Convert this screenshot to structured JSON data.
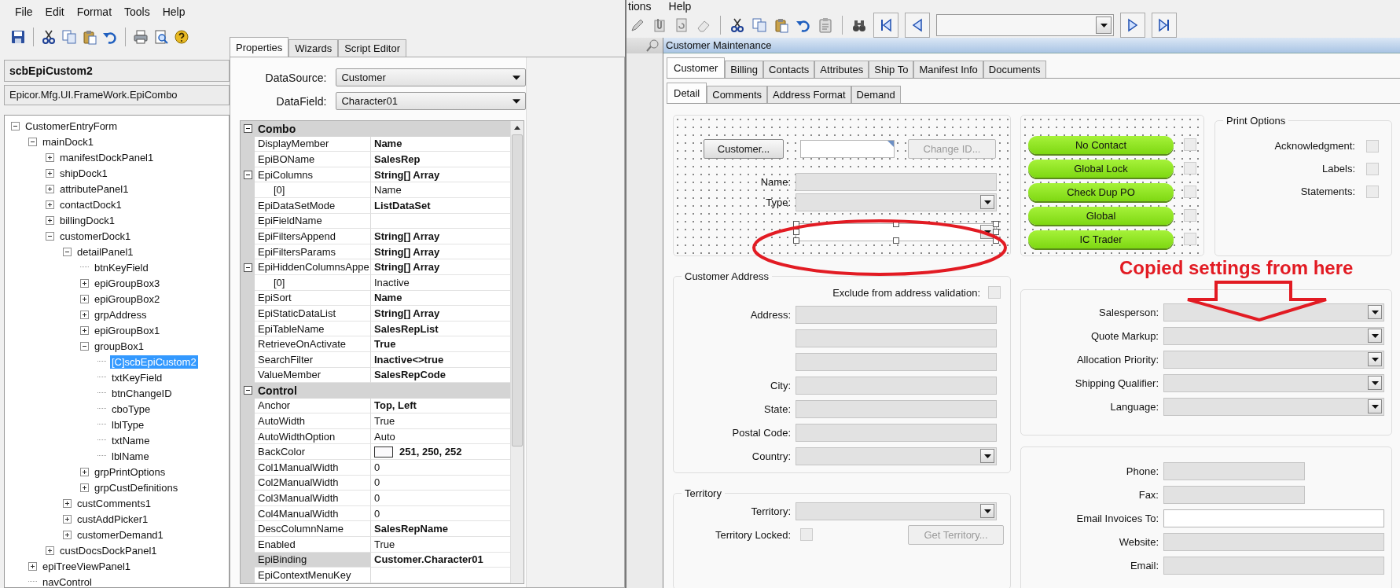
{
  "left_window": {
    "menu": [
      "File",
      "Edit",
      "Format",
      "Tools",
      "Help"
    ],
    "object_name": "scbEpiCustom2",
    "object_type": "Epicor.Mfg.UI.FrameWork.EpiCombo",
    "tree": [
      {
        "label": "CustomerEntryForm",
        "selected": false,
        "expanded": true,
        "children": [
          {
            "label": "mainDock1",
            "selected": false,
            "expanded": true,
            "children": [
              {
                "label": "manifestDockPanel1",
                "selected": false,
                "expanded": false
              },
              {
                "label": "shipDock1",
                "selected": false,
                "expanded": false
              },
              {
                "label": "attributePanel1",
                "selected": false,
                "expanded": false
              },
              {
                "label": "contactDock1",
                "selected": false,
                "expanded": false
              },
              {
                "label": "billingDock1",
                "selected": false,
                "expanded": false
              },
              {
                "label": "customerDock1",
                "selected": false,
                "expanded": true,
                "children": [
                  {
                    "label": "detailPanel1",
                    "selected": false,
                    "expanded": true,
                    "children": [
                      {
                        "label": "btnKeyField",
                        "selected": false
                      },
                      {
                        "label": "epiGroupBox3",
                        "selected": false,
                        "expanded": false
                      },
                      {
                        "label": "epiGroupBox2",
                        "selected": false,
                        "expanded": false
                      },
                      {
                        "label": "grpAddress",
                        "selected": false,
                        "expanded": false
                      },
                      {
                        "label": "epiGroupBox1",
                        "selected": false,
                        "expanded": false
                      },
                      {
                        "label": "groupBox1",
                        "selected": false,
                        "expanded": true,
                        "children": [
                          {
                            "label": "[C]scbEpiCustom2",
                            "selected": true
                          },
                          {
                            "label": "txtKeyField",
                            "selected": false
                          },
                          {
                            "label": "btnChangeID",
                            "selected": false
                          },
                          {
                            "label": "cboType",
                            "selected": false
                          },
                          {
                            "label": "lblType",
                            "selected": false
                          },
                          {
                            "label": "txtName",
                            "selected": false
                          },
                          {
                            "label": "lblName",
                            "selected": false
                          }
                        ]
                      },
                      {
                        "label": "grpPrintOptions",
                        "selected": false,
                        "expanded": false
                      },
                      {
                        "label": "grpCustDefinitions",
                        "selected": false,
                        "expanded": false
                      }
                    ]
                  },
                  {
                    "label": "custComments1",
                    "selected": false,
                    "expanded": false
                  },
                  {
                    "label": "custAddPicker1",
                    "selected": false,
                    "expanded": false
                  },
                  {
                    "label": "customerDemand1",
                    "selected": false,
                    "expanded": false
                  }
                ]
              },
              {
                "label": "custDocsDockPanel1",
                "selected": false,
                "expanded": false
              }
            ]
          },
          {
            "label": "epiTreeViewPanel1",
            "selected": false,
            "expanded": false
          },
          {
            "label": "navControl",
            "selected": false
          }
        ]
      }
    ]
  },
  "properties_panel": {
    "tabs": [
      {
        "label": "Properties",
        "selected": true
      },
      {
        "label": "Wizards",
        "selected": false
      },
      {
        "label": "Script Editor",
        "selected": false
      }
    ],
    "data_source": {
      "label": "DataSource:",
      "value": "Customer"
    },
    "data_field": {
      "label": "DataField:",
      "value": "Character01"
    },
    "categories": [
      {
        "name": "Combo",
        "expanded": true,
        "rows": [
          {
            "name": "DisplayMember",
            "value": "Name",
            "bold": true,
            "selected": false
          },
          {
            "name": "EpiBOName",
            "value": "SalesRep",
            "bold": true,
            "selected": false
          },
          {
            "name": "EpiColumns",
            "value": "String[] Array",
            "bold": true,
            "selected": false,
            "expanded": true,
            "children": [
              {
                "name": "[0]",
                "value": "Name",
                "bold": false,
                "selected": false
              }
            ]
          },
          {
            "name": "EpiDataSetMode",
            "value": "ListDataSet",
            "bold": true,
            "selected": false
          },
          {
            "name": "EpiFieldName",
            "selected": false
          },
          {
            "name": "EpiFiltersAppend",
            "value": "String[] Array",
            "bold": true,
            "selected": false
          },
          {
            "name": "EpiFiltersParams",
            "value": "String[] Array",
            "bold": true,
            "selected": false
          },
          {
            "name": "EpiHiddenColumnsAppe",
            "value": "String[] Array",
            "bold": true,
            "selected": false,
            "expanded": true,
            "children": [
              {
                "name": "[0]",
                "value": "Inactive",
                "bold": false,
                "selected": false
              }
            ]
          },
          {
            "name": "EpiSort",
            "value": "Name",
            "bold": true,
            "selected": false
          },
          {
            "name": "EpiStaticDataList",
            "value": "String[] Array",
            "bold": true,
            "selected": false
          },
          {
            "name": "EpiTableName",
            "value": "SalesRepList",
            "bold": true,
            "selected": false
          },
          {
            "name": "RetrieveOnActivate",
            "value": "True",
            "bold": true,
            "selected": false
          },
          {
            "name": "SearchFilter",
            "value": "Inactive<>true",
            "bold": true,
            "selected": false
          },
          {
            "name": "ValueMember",
            "value": "SalesRepCode",
            "bold": true,
            "selected": false
          }
        ]
      },
      {
        "name": "Control",
        "expanded": true,
        "rows": [
          {
            "name": "Anchor",
            "value": "Top, Left",
            "bold": true,
            "selected": false
          },
          {
            "name": "AutoWidth",
            "value": "True",
            "bold": false,
            "selected": false
          },
          {
            "name": "AutoWidthOption",
            "value": "Auto",
            "bold": false,
            "selected": false
          },
          {
            "name": "BackColor",
            "value": "251, 250, 252",
            "bold": true,
            "selected": false,
            "color": "#fbfafc"
          },
          {
            "name": "Col1ManualWidth",
            "value": "0",
            "bold": false,
            "selected": false
          },
          {
            "name": "Col2ManualWidth",
            "value": "0",
            "bold": false,
            "selected": false
          },
          {
            "name": "Col3ManualWidth",
            "value": "0",
            "bold": false,
            "selected": false
          },
          {
            "name": "Col4ManualWidth",
            "value": "0",
            "bold": false,
            "selected": false
          },
          {
            "name": "DescColumnName",
            "value": "SalesRepName",
            "bold": true,
            "selected": false
          },
          {
            "name": "Enabled",
            "value": "True",
            "bold": false,
            "selected": false
          },
          {
            "name": "EpiBinding",
            "value": "Customer.Character01",
            "bold": true,
            "selected": true
          },
          {
            "name": "EpiContextMenuKey",
            "selected": false
          }
        ]
      }
    ]
  },
  "right_window": {
    "menu": [
      "tions",
      "Help"
    ],
    "title": "Customer Maintenance",
    "tabs": [
      {
        "label": "Customer",
        "selected": true
      },
      {
        "label": "Billing",
        "selected": false
      },
      {
        "label": "Contacts",
        "selected": false
      },
      {
        "label": "Attributes",
        "selected": false
      },
      {
        "label": "Ship To",
        "selected": false
      },
      {
        "label": "Manifest Info",
        "selected": false
      },
      {
        "label": "Documents",
        "selected": false
      }
    ],
    "subtabs": [
      {
        "label": "Detail",
        "selected": true
      },
      {
        "label": "Comments",
        "selected": false
      },
      {
        "label": "Address Format",
        "selected": false
      },
      {
        "label": "Demand",
        "selected": false
      }
    ],
    "header": {
      "customer_button": {
        "label": "Customer...",
        "disabled": false
      },
      "id_field": {
        "kind": "key",
        "disabled": false
      },
      "change_id_button": {
        "label": "Change ID...",
        "disabled": true
      },
      "fields": [
        {
          "label": "Name:",
          "kind": "text",
          "disabled": true,
          "selected": false
        },
        {
          "label": "Type:",
          "kind": "combo",
          "disabled": true,
          "selected": false
        },
        {
          "kind": "combo",
          "disabled": false,
          "selected": true
        }
      ]
    },
    "flags": [
      {
        "label": "No Contact",
        "checked": false
      },
      {
        "label": "Global Lock",
        "checked": false
      },
      {
        "label": "Check Dup PO",
        "checked": false
      },
      {
        "label": "Global",
        "checked": false
      },
      {
        "label": "IC Trader",
        "checked": false
      }
    ],
    "print_options": {
      "title": "Print Options",
      "items": [
        {
          "label": "Acknowledgment:",
          "checked": false
        },
        {
          "label": "Labels:",
          "checked": false
        },
        {
          "label": "Statements:",
          "checked": false
        }
      ]
    },
    "address": {
      "title": "Customer Address",
      "exclude": {
        "label": "Exclude from address validation:",
        "checked": false
      },
      "fields": [
        {
          "label": "Address:",
          "kind": "text",
          "disabled": true
        },
        {
          "kind": "text",
          "disabled": true
        },
        {
          "kind": "text",
          "disabled": true
        },
        {
          "label": "City:",
          "kind": "text",
          "disabled": true
        },
        {
          "label": "State:",
          "kind": "text",
          "disabled": true
        },
        {
          "label": "Postal Code:",
          "kind": "text",
          "disabled": true
        },
        {
          "label": "Country:",
          "kind": "combo",
          "disabled": true
        }
      ]
    },
    "territory": {
      "title": "Territory",
      "fields": [
        {
          "label": "Territory:",
          "kind": "combo",
          "disabled": true
        }
      ],
      "locked": {
        "label": "Territory Locked:",
        "checked": false
      },
      "get_button": {
        "label": "Get Territory...",
        "disabled": true
      }
    },
    "sales": {
      "fields": [
        {
          "label": "Salesperson:",
          "kind": "combo",
          "disabled": true
        },
        {
          "label": "Quote Markup:",
          "kind": "combo",
          "disabled": true
        },
        {
          "label": "Allocation Priority:",
          "kind": "combo",
          "disabled": true
        },
        {
          "label": "Shipping Qualifier:",
          "kind": "combo",
          "disabled": true
        },
        {
          "label": "Language:",
          "kind": "combo",
          "disabled": true
        }
      ]
    },
    "contact": {
      "fields": [
        {
          "label": "Phone:",
          "kind": "short",
          "disabled": true
        },
        {
          "label": "Fax:",
          "kind": "short",
          "disabled": true
        },
        {
          "label": "Email Invoices To:",
          "kind": "text",
          "disabled": false
        },
        {
          "label": "Website:",
          "kind": "text",
          "disabled": true
        },
        {
          "label": "Email:",
          "kind": "text",
          "disabled": true
        }
      ]
    },
    "annotation": "Copied settings from here"
  }
}
